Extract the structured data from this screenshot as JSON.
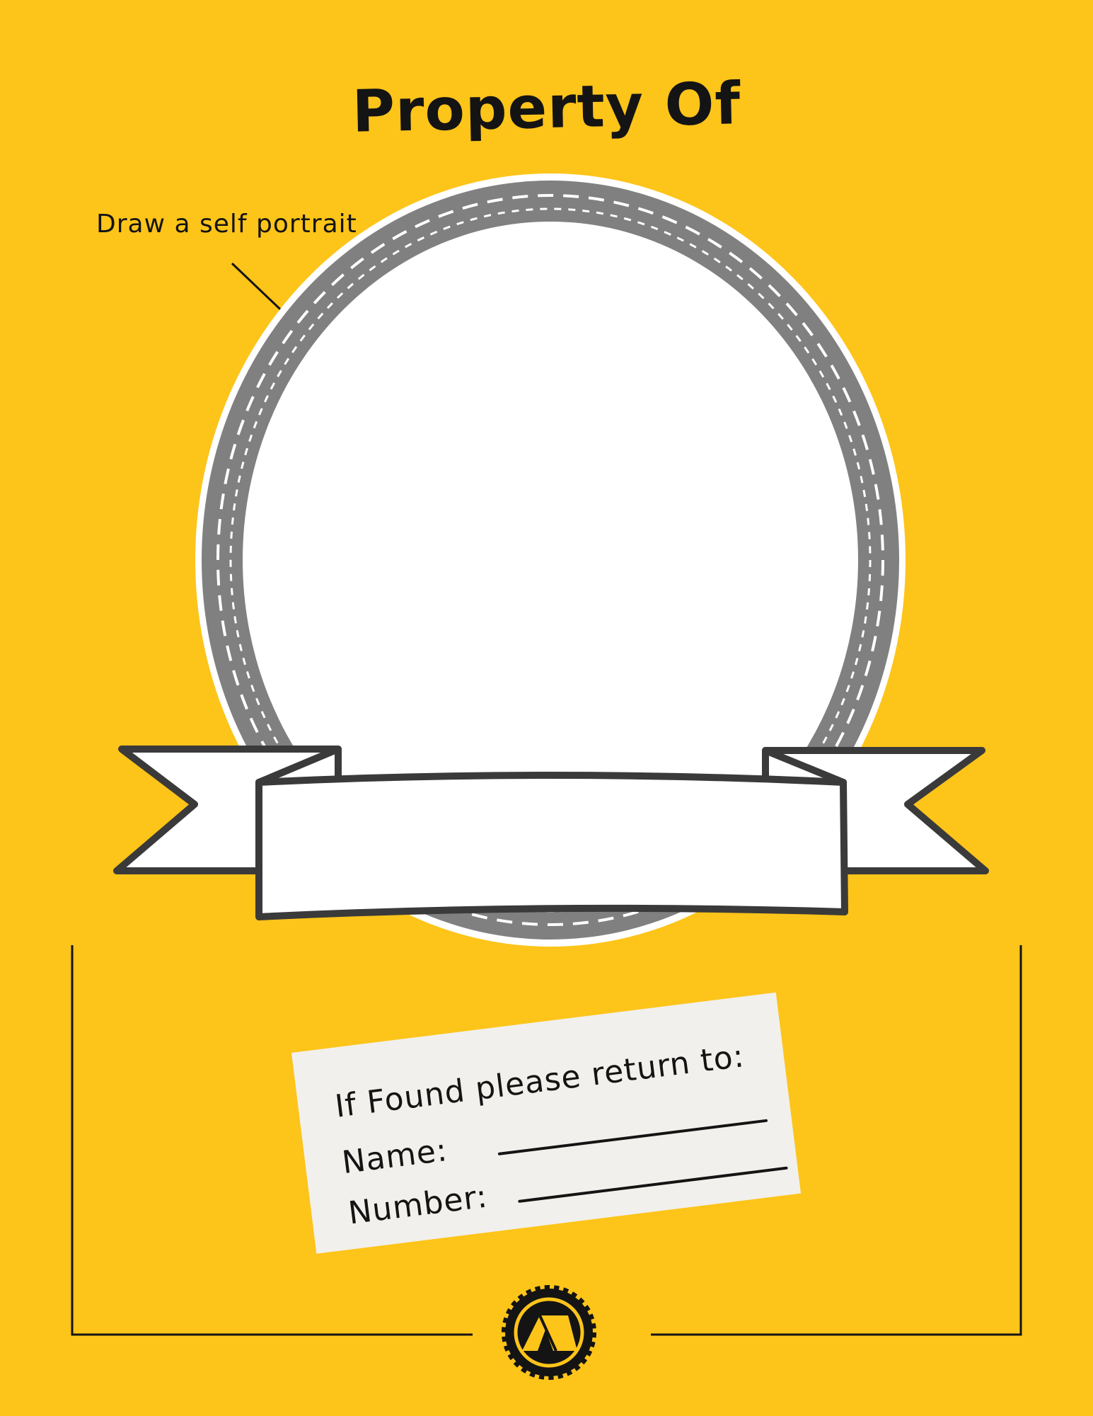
{
  "header": {
    "title": "Property Of"
  },
  "portrait": {
    "hint_text": "Draw a self portrait"
  },
  "return_card": {
    "heading": "If Found please return to:",
    "name_label": "Name:",
    "number_label": "Number:"
  },
  "logo": {
    "icon": "tent-gear-icon"
  },
  "colors": {
    "background": "#FDC41A",
    "ring": "#7F7F7F",
    "ink": "#141414",
    "card": "#F1F0EC"
  }
}
